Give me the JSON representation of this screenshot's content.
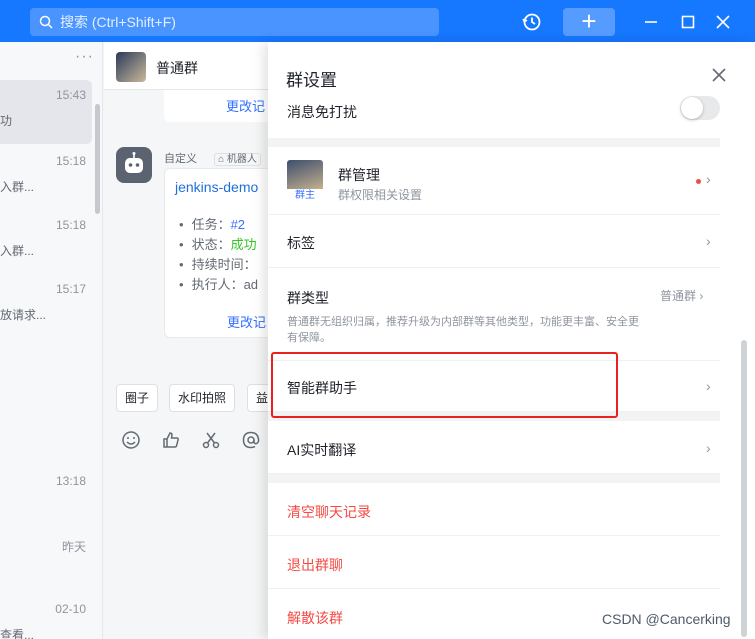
{
  "titlebar": {
    "search_placeholder": "搜索 (Ctrl+Shift+F)",
    "plus_label": "+",
    "accent_color": "#1677ff"
  },
  "conversations": {
    "more": "···",
    "items": [
      {
        "time": "15:43",
        "snippet": "功"
      },
      {
        "time": "15:18",
        "snippet": "入群..."
      },
      {
        "time": "15:18",
        "snippet": "入群..."
      },
      {
        "time": "15:17",
        "snippet": "放请求..."
      },
      {
        "time": "13:18",
        "snippet": ""
      },
      {
        "time": "昨天",
        "snippet": ""
      },
      {
        "time": "02-10",
        "snippet": "查看..."
      }
    ]
  },
  "chat": {
    "group_name": "普通群",
    "card1_link": "更改记",
    "sender": "自定义",
    "sender_tag": "机器人",
    "card2": {
      "title": "jenkins-demo",
      "task_label": "任务：",
      "task_value": "#2",
      "status_label": "状态：",
      "status_value": "成功",
      "duration_label": "持续时间：",
      "executor_label": "执行人：",
      "executor_value": "ad",
      "link": "更改记"
    },
    "chips": [
      "圈子",
      "水印拍照",
      "益"
    ]
  },
  "panel": {
    "title": "群设置",
    "do_not_disturb": "消息免打扰",
    "manage_title": "群管理",
    "manage_sub": "群权限相关设置",
    "owner_badge": "群主",
    "tags": "标签",
    "type_title": "群类型",
    "type_value": "普通群",
    "type_desc": "普通群无组织归属，推荐升级为内部群等其他类型，功能更丰富、安全更有保障。",
    "smart_assistant": "智能群助手",
    "ai_translate": "AI实时翻译",
    "clear_history": "清空聊天记录",
    "leave_group": "退出群聊",
    "dissolve_group": "解散该群",
    "chevron": "›",
    "danger_color": "#f54a45"
  },
  "watermark": "CSDN @Cancerking"
}
